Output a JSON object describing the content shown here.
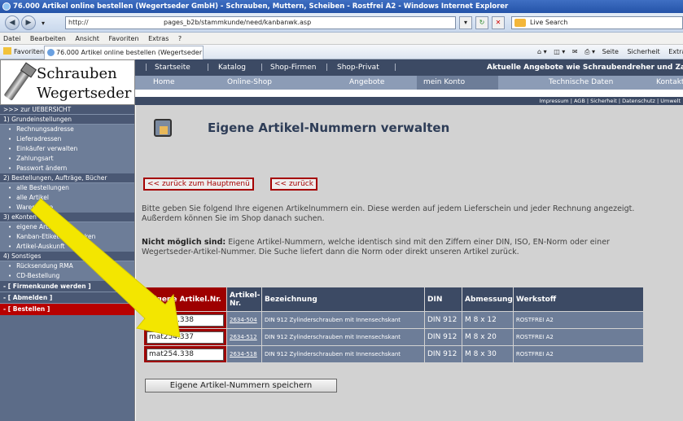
{
  "browser": {
    "title": "76.000 Artikel online bestellen (Wegertseder GmbH) - Schrauben, Muttern, Scheiben - Rostfrei A2 - Windows Internet Explorer",
    "address_prefix": "http://",
    "address_path": "pages_b2b/stammkunde/need/kanbanwk.asp",
    "search_placeholder": "Live Search",
    "menu": [
      "Datei",
      "Bearbeiten",
      "Ansicht",
      "Favoriten",
      "Extras",
      "?"
    ],
    "favorites_label": "Favoriten",
    "tab_title": "76.000 Artikel online bestellen (Wegertseder GmbH) - ...",
    "toolbar_tools": [
      "Seite",
      "Sicherheit",
      "Extras"
    ]
  },
  "logo": {
    "line1": "Schrauben",
    "line2": "Wegertseder"
  },
  "topnav": [
    "Startseite",
    "Katalog",
    "Shop-Firmen",
    "Shop-Privat"
  ],
  "ticker": "Aktuelle Angebote wie Schraubendreher und Zangen",
  "subnav": [
    "Home",
    "Online-Shop",
    "Angebote",
    "mein Konto",
    "Technische Daten",
    "Kontakt"
  ],
  "impressum": "Impressum | AGB | Sicherheit | Datenschutz | Umwelt",
  "sidebar": {
    "overview": ">>> zur UEBERSICHT",
    "sections": [
      {
        "title": "1) Grundeinstellungen",
        "items": [
          "Rechnungsadresse",
          "Lieferadressen",
          "Einkäufer verwalten",
          "Zahlungsart",
          "Passwort ändern"
        ]
      },
      {
        "title": "2) Bestellungen, Aufträge, Bücher",
        "items": [
          "alle Bestellungen",
          "alle Artikel",
          "Warenkörbe"
        ]
      },
      {
        "title": "3) eKonten",
        "items": [
          "eigene Artikel-Nr.",
          "Kanban-Etiketten drucken",
          "Artikel-Auskunft"
        ]
      },
      {
        "title": "4) Sonstiges",
        "items": [
          "Rücksendung RMA",
          "CD-Bestellung"
        ]
      }
    ],
    "firmenkunde": "- [ Firmenkunde werden ]",
    "abmelden": "- [ Abmelden ]",
    "bestellen": "- [ Bestellen ]"
  },
  "page": {
    "title": "Eigene Artikel-Nummern verwalten",
    "back_main": "<< zurück zum Hauptmenü",
    "back": "<< zurück",
    "intro": "Bitte geben Sie folgend Ihre eigenen Artikelnummern ein. Diese werden auf jedem Lieferschein und jeder Rechnung angezeigt. Außerdem können Sie im Shop danach suchen.",
    "note_bold": "Nicht möglich sind:",
    "note": " Eigene Artikel-Nummern, welche identisch sind mit den Ziffern einer DIN, ISO, EN-Norm oder einer Wegertseder-Artikel-Nummer. Die Suche liefert dann die Norm oder direkt unseren Artikel zurück.",
    "save_button": "Eigene Artikel-Nummern speichern"
  },
  "table": {
    "headers": [
      "Eigene Artikel.Nr.",
      "Artikel-Nr.",
      "Bezeichnung",
      "DIN",
      "Abmessung",
      "Werkstoff"
    ],
    "rows": [
      {
        "eigene": "mat254.338",
        "artikel": "2634-504",
        "bezeichnung": "DIN 912 Zylinderschrauben mit Innensechskant",
        "din": "DIN 912",
        "abmessung": "M 8 x 12",
        "werkstoff": "ROSTFREI A2"
      },
      {
        "eigene": "mat254.337",
        "artikel": "2634-512",
        "bezeichnung": "DIN 912 Zylinderschrauben mit Innensechskant",
        "din": "DIN 912",
        "abmessung": "M 8 x 20",
        "werkstoff": "ROSTFREI A2"
      },
      {
        "eigene": "mat254.338",
        "artikel": "2634-518",
        "bezeichnung": "DIN 912 Zylinderschrauben mit Innensechskant",
        "din": "DIN 912",
        "abmessung": "M 8 x 30",
        "werkstoff": "ROSTFREI A2"
      }
    ]
  },
  "colors": {
    "nav_dark": "#3c4a64",
    "nav_light": "#8c9cb6",
    "sidebar": "#5c6c88",
    "accent_red": "#9e0000",
    "arrow": "#f3e600"
  }
}
